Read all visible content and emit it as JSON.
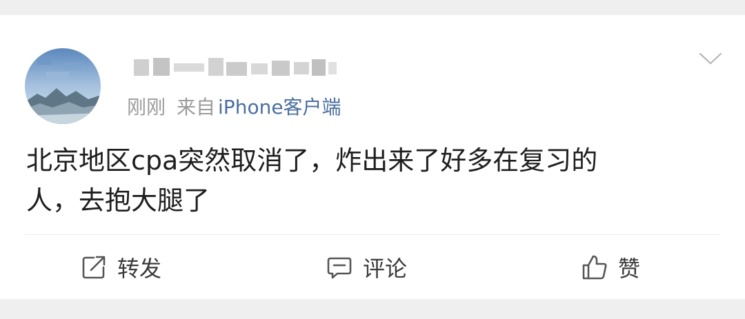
{
  "post": {
    "username": "",
    "time": "刚刚",
    "source_prefix": "来自",
    "source_name": "iPhone客户端",
    "content_line1": "北京地区cpa突然取消了，炸出来了好多在复习的",
    "content_line2": "人，去抱大腿了"
  },
  "actions": {
    "repost_label": "转发",
    "comment_label": "评论",
    "like_label": "赞"
  },
  "icons": {
    "dropdown": "chevron-down-icon",
    "repost": "share-icon",
    "comment": "comment-icon",
    "like": "thumbs-up-icon"
  },
  "colors": {
    "background": "#efefef",
    "card": "#ffffff",
    "link": "#4a6e9f",
    "meta": "#9a9a9a",
    "text": "#1e1e1e",
    "action": "#3a3a3a"
  }
}
